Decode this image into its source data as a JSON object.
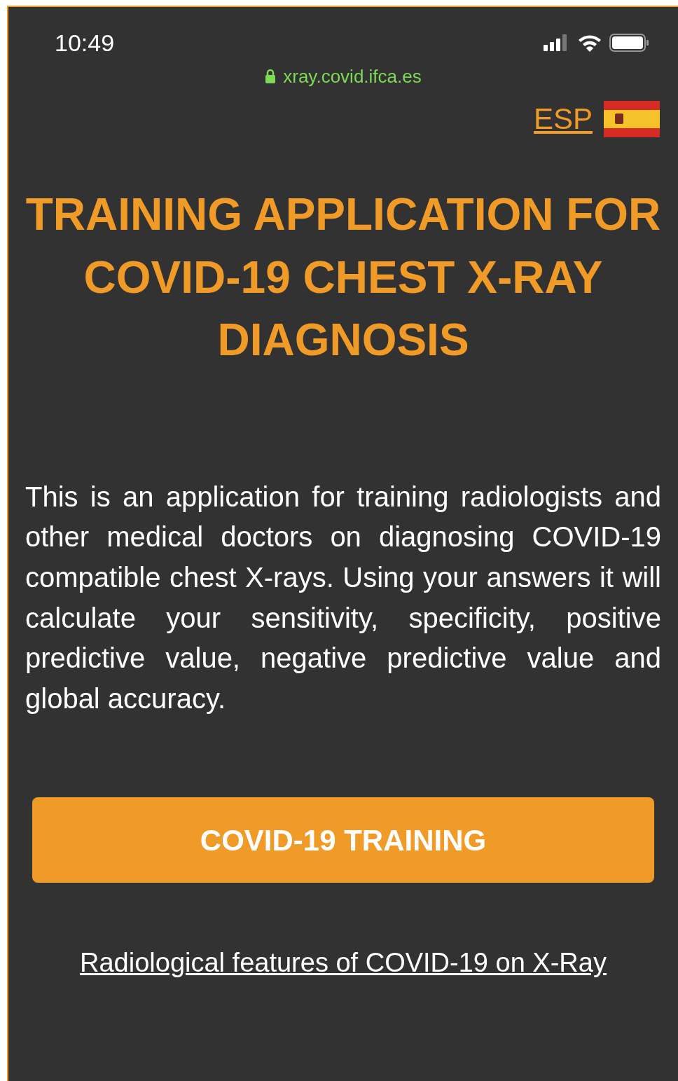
{
  "status_bar": {
    "time": "10:49"
  },
  "address_bar": {
    "url": "xray.covid.ifca.es"
  },
  "language_link": {
    "label": "ESP"
  },
  "title": "TRAINING APPLICATION FOR COVID-19 CHEST X-RAY DIAGNOSIS",
  "description": "This is an application for training radiologists and other medical doctors on diagnosing COVID-19 compatible chest X-rays. Using your answers it will calculate your sensitivity, specificity, positive predictive value, negative predictive value and global accuracy.",
  "primary_button": {
    "label": "COVID-19 TRAINING"
  },
  "footer_link": {
    "label": "Radiological features of COVID-19 on X-Ray"
  }
}
